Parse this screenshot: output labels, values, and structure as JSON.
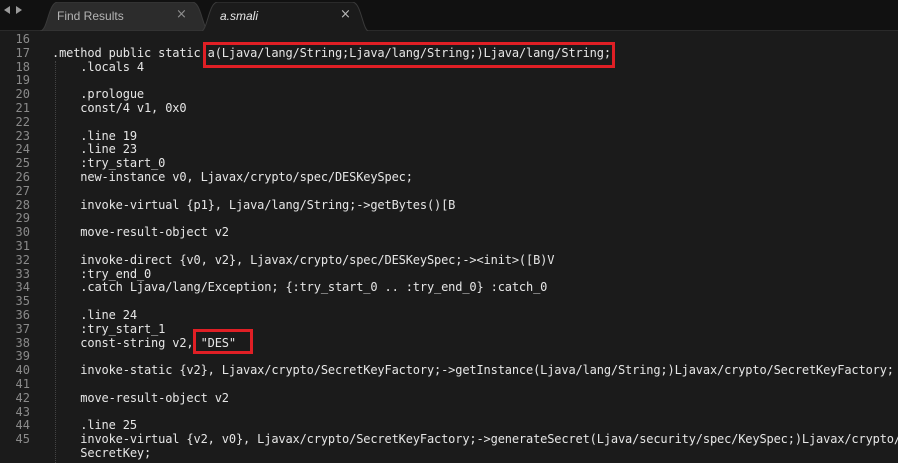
{
  "tabs": [
    {
      "label": "Find Results",
      "close": "×",
      "active": false
    },
    {
      "label": "a.smali",
      "close": "×",
      "active": true
    }
  ],
  "editor": {
    "lines": [
      {
        "no": "16",
        "text": ""
      },
      {
        "no": "17",
        "text": ".method public static a(Ljava/lang/String;Ljava/lang/String;)Ljava/lang/String;"
      },
      {
        "no": "18",
        "text": "    .locals 4"
      },
      {
        "no": "19",
        "text": ""
      },
      {
        "no": "20",
        "text": "    .prologue"
      },
      {
        "no": "21",
        "text": "    const/4 v1, 0x0"
      },
      {
        "no": "22",
        "text": ""
      },
      {
        "no": "23",
        "text": "    .line 19"
      },
      {
        "no": "24",
        "text": "    .line 23"
      },
      {
        "no": "25",
        "text": "    :try_start_0"
      },
      {
        "no": "26",
        "text": "    new-instance v0, Ljavax/crypto/spec/DESKeySpec;"
      },
      {
        "no": "27",
        "text": ""
      },
      {
        "no": "28",
        "text": "    invoke-virtual {p1}, Ljava/lang/String;->getBytes()[B"
      },
      {
        "no": "29",
        "text": ""
      },
      {
        "no": "30",
        "text": "    move-result-object v2"
      },
      {
        "no": "31",
        "text": ""
      },
      {
        "no": "32",
        "text": "    invoke-direct {v0, v2}, Ljavax/crypto/spec/DESKeySpec;-><init>([B)V"
      },
      {
        "no": "33",
        "text": "    :try_end_0"
      },
      {
        "no": "34",
        "text": "    .catch Ljava/lang/Exception; {:try_start_0 .. :try_end_0} :catch_0"
      },
      {
        "no": "35",
        "text": ""
      },
      {
        "no": "36",
        "text": "    .line 24"
      },
      {
        "no": "37",
        "text": "    :try_start_1"
      },
      {
        "no": "38",
        "text": "    const-string v2, \"DES\""
      },
      {
        "no": "39",
        "text": ""
      },
      {
        "no": "40",
        "text": "    invoke-static {v2}, Ljavax/crypto/SecretKeyFactory;->getInstance(Ljava/lang/String;)Ljavax/crypto/SecretKeyFactory;"
      },
      {
        "no": "41",
        "text": ""
      },
      {
        "no": "42",
        "text": "    move-result-object v2"
      },
      {
        "no": "43",
        "text": ""
      },
      {
        "no": "44",
        "text": "    .line 25"
      },
      {
        "no": "45",
        "text": "    invoke-virtual {v2, v0}, Ljavax/crypto/SecretKeyFactory;->generateSecret(Ljava/security/spec/KeySpec;)Ljavax/crypto/"
      },
      {
        "no": "",
        "text": "    SecretKey;"
      }
    ]
  },
  "colors": {
    "background": "#1b1b1b",
    "text": "#e6e6e6",
    "line_numbers": "#8a8a8a",
    "highlight": "#e01f25"
  }
}
